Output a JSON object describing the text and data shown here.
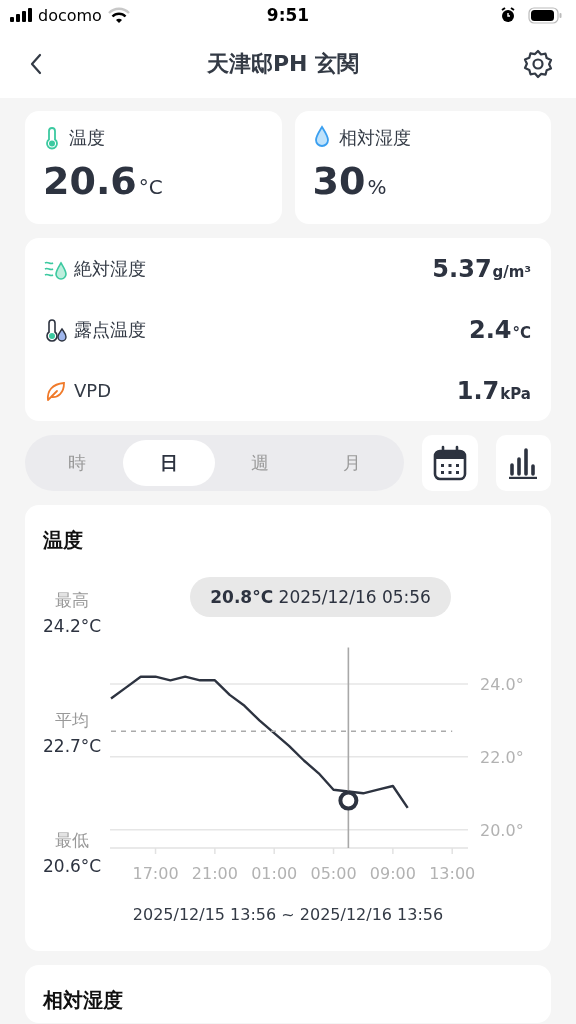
{
  "status_bar": {
    "carrier": "docomo",
    "time": "9:51"
  },
  "nav": {
    "title": "天津邸PH 玄関"
  },
  "summary": [
    {
      "kind": "temperature",
      "label": "温度",
      "value": "20.6",
      "unit": "°C"
    },
    {
      "kind": "humidity",
      "label": "相対湿度",
      "value": "30",
      "unit": "%"
    }
  ],
  "metrics": [
    {
      "kind": "absolute_humidity",
      "label": "絶対湿度",
      "value": "5.37",
      "unit": "g/m³"
    },
    {
      "kind": "dew_point",
      "label": "露点温度",
      "value": "2.4",
      "unit": "°C"
    },
    {
      "kind": "vpd",
      "label": "VPD",
      "value": "1.7",
      "unit": "kPa"
    }
  ],
  "periods": [
    {
      "label": "時",
      "selected": false
    },
    {
      "label": "日",
      "selected": true
    },
    {
      "label": "週",
      "selected": false
    },
    {
      "label": "月",
      "selected": false
    }
  ],
  "chart_card": {
    "stats": [
      {
        "label": "最高",
        "value": "24.2°C"
      },
      {
        "value": "22.7°C"
      },
      {
        "label": "最低",
        "value": "20.6°C"
      }
    ],
    "range": "2025/12/15 13:56 ~ 2025/12/16 13:56",
    "chart_data": {
      "type": "line",
      "grid": true,
      "categories": [
        null,
        null,
        null,
        "17:00",
        null,
        null,
        null,
        "21:00",
        null,
        null,
        null,
        "01:00",
        null,
        null,
        null,
        "05:00",
        null,
        null,
        null,
        "09:00",
        null,
        null,
        null,
        "13:00"
      ],
      "series": [
        {
          "name": "温度",
          "color": "#2d3340",
          "values": [
            23.6,
            23.9,
            24.2,
            24.2,
            24.1,
            24.2,
            24.1,
            24.1,
            23.7,
            23.4,
            23.0,
            22.65,
            22.3,
            21.9,
            21.55,
            21.1,
            null,
            21.0,
            21.1,
            21.2,
            20.6,
            null,
            null,
            null
          ]
        },
        {
          "name": "平均",
          "color": "#aaaaaa",
          "line_style": "dashed",
          "values": [
            22.7,
            22.7,
            22.7,
            22.7,
            22.7,
            22.7,
            22.7,
            22.7,
            22.7,
            22.7,
            22.7,
            22.7,
            22.7,
            22.7,
            22.7,
            22.7,
            22.7,
            22.7,
            22.7,
            22.7,
            22.7,
            22.7,
            22.7,
            22.7
          ]
        },
        {
          "color": "#2d3340",
          "marker": "circle",
          "values": [
            null,
            null,
            null,
            null,
            null,
            null,
            null,
            null,
            null,
            null,
            null,
            null,
            null,
            null,
            null,
            null,
            20.8,
            null,
            null,
            null,
            null,
            null,
            null,
            null
          ]
        }
      ],
      "ylim": [
        19.5,
        25
      ],
      "yticks": [
        {
          "value": 20,
          "label": "20.0°"
        },
        {
          "value": 22,
          "label": "22.0°"
        },
        {
          "value": 24,
          "label": "24.0°"
        }
      ],
      "annotations": [
        "**20.8°C** 2025/12/16 05:56"
      ]
    }
  },
  "next_card": {
    "title": "相対湿度"
  }
}
